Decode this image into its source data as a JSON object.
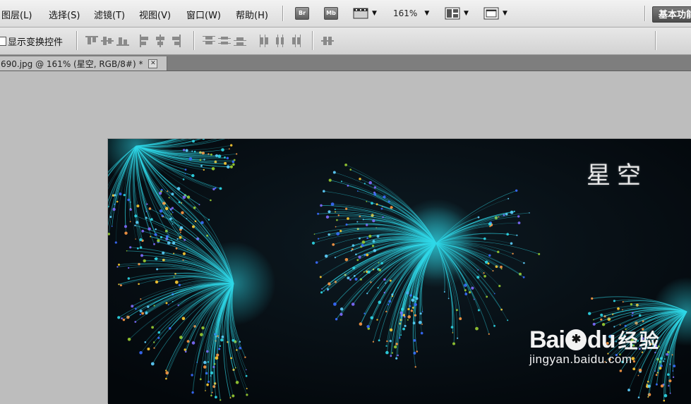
{
  "menubar": {
    "items": [
      "图层(L)",
      "选择(S)",
      "滤镜(T)",
      "视图(V)",
      "窗口(W)",
      "帮助(H)"
    ],
    "bridge_badge": "Br",
    "minibridge_badge": "Mb",
    "zoom_level": "161%",
    "workspace": "基本功能"
  },
  "options": {
    "show_transform_controls": "显示变换控件"
  },
  "document": {
    "tab_title": "690.jpg @ 161% (星空, RGB/8#) *",
    "close": "✕"
  },
  "image": {
    "title_text": "星空",
    "watermark_logo_left": "Bai",
    "watermark_logo_paw": "✱",
    "watermark_logo_right": "du",
    "watermark_cn": "经验",
    "watermark_url": "jingyan.baidu.com"
  },
  "colors": {
    "accent_cyan": "#2fd8e8",
    "image_bg": "#060d13"
  }
}
